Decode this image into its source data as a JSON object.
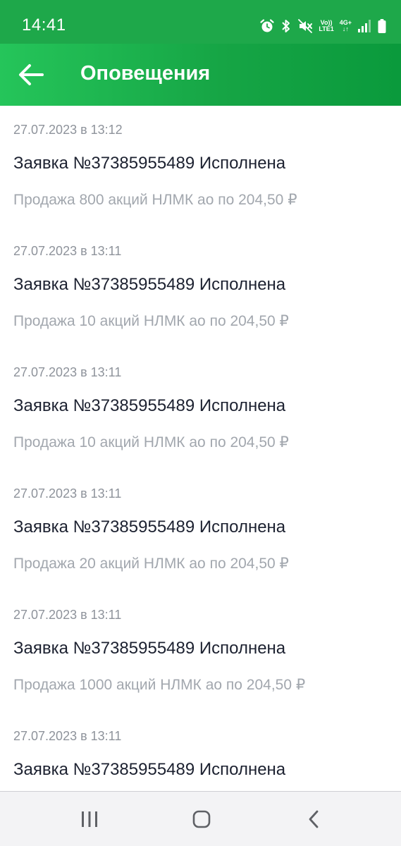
{
  "status_bar": {
    "time": "14:41",
    "network_top": "Vo))",
    "network_bottom": "LTE1",
    "data_type": "4G+",
    "icons": [
      "alarm-icon",
      "bluetooth-icon",
      "mute-icon",
      "volte-icon",
      "4g-data-icon",
      "signal-icon",
      "battery-icon"
    ]
  },
  "app_bar": {
    "title": "Оповещения",
    "back_icon": "arrow-left-icon"
  },
  "notifications": [
    {
      "date": "27.07.2023 в 13:12",
      "title": "Заявка №37385955489 Исполнена",
      "description": "Продажа 800 акций НЛМК ао по 204,50 ₽"
    },
    {
      "date": "27.07.2023 в 13:11",
      "title": "Заявка №37385955489 Исполнена",
      "description": "Продажа 10 акций НЛМК ао по 204,50 ₽"
    },
    {
      "date": "27.07.2023 в 13:11",
      "title": "Заявка №37385955489 Исполнена",
      "description": "Продажа 10 акций НЛМК ао по 204,50 ₽"
    },
    {
      "date": "27.07.2023 в 13:11",
      "title": "Заявка №37385955489 Исполнена",
      "description": "Продажа 20 акций НЛМК ао по 204,50 ₽"
    },
    {
      "date": "27.07.2023 в 13:11",
      "title": "Заявка №37385955489 Исполнена",
      "description": "Продажа 1000 акций НЛМК ао по 204,50 ₽"
    },
    {
      "date": "27.07.2023 в 13:11",
      "title": "Заявка №37385955489 Исполнена",
      "description": ""
    }
  ],
  "nav_bar": {
    "buttons": [
      "recent-apps-icon",
      "home-icon",
      "back-icon"
    ]
  },
  "colors": {
    "status_bar_bg": "#1ea84a",
    "app_bar_start": "#25c55a",
    "app_bar_end": "#0a9a3c",
    "title_text": "#1c2130",
    "date_text": "#8e939b",
    "description_text": "#a2a7ae"
  }
}
